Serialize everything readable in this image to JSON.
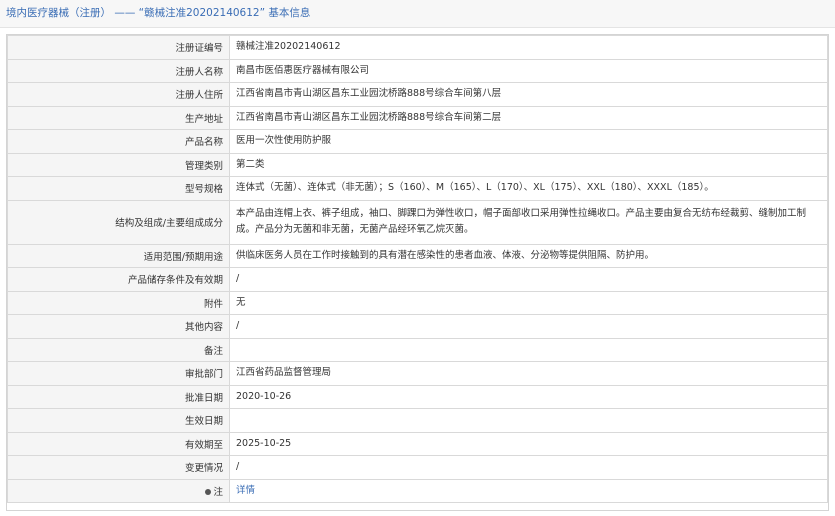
{
  "header": {
    "breadcrumb": "境内医疗器械（注册） —— “赣械注准20202140612” 基本信息"
  },
  "rows": [
    {
      "label": "注册证编号",
      "value": "赣械注准20202140612"
    },
    {
      "label": "注册人名称",
      "value": "南昌市医佰惠医疗器械有限公司"
    },
    {
      "label": "注册人住所",
      "value": "江西省南昌市青山湖区昌东工业园沈桥路888号综合车间第八层"
    },
    {
      "label": "生产地址",
      "value": "江西省南昌市青山湖区昌东工业园沈桥路888号综合车间第二层"
    },
    {
      "label": "产品名称",
      "value": "医用一次性使用防护服"
    },
    {
      "label": "管理类别",
      "value": "第二类"
    },
    {
      "label": "型号规格",
      "value": "连体式（无菌）、连体式（非无菌）；S（160）、M（165）、L（170）、XL（175）、XXL（180）、XXXL（185）。"
    },
    {
      "label": "结构及组成/主要组成成分",
      "value": "本产品由连帽上衣、裤子组成，袖口、脚踝口为弹性收口，帽子面部收口采用弹性拉绳收口。产品主要由复合无纺布经裁剪、缝制加工制成。产品分为无菌和非无菌，无菌产品经环氧乙烷灭菌。"
    },
    {
      "label": "适用范围/预期用途",
      "value": "供临床医务人员在工作时接触到的具有潜在感染性的患者血液、体液、分泌物等提供阻隔、防护用。"
    },
    {
      "label": "产品储存条件及有效期",
      "value": "/"
    },
    {
      "label": "附件",
      "value": "无"
    },
    {
      "label": "其他内容",
      "value": "/"
    },
    {
      "label": "备注",
      "value": ""
    },
    {
      "label": "审批部门",
      "value": "江西省药品监督管理局"
    },
    {
      "label": "批准日期",
      "value": "2020-10-26"
    },
    {
      "label": "生效日期",
      "value": ""
    },
    {
      "label": "有效期至",
      "value": "2025-10-25"
    },
    {
      "label": "变更情况",
      "value": "/"
    },
    {
      "label": "注",
      "value": "详情"
    }
  ],
  "colors": {
    "link": "#3a6db5",
    "label_bg": "#f5f5f5",
    "border": "#d9d9d9"
  }
}
